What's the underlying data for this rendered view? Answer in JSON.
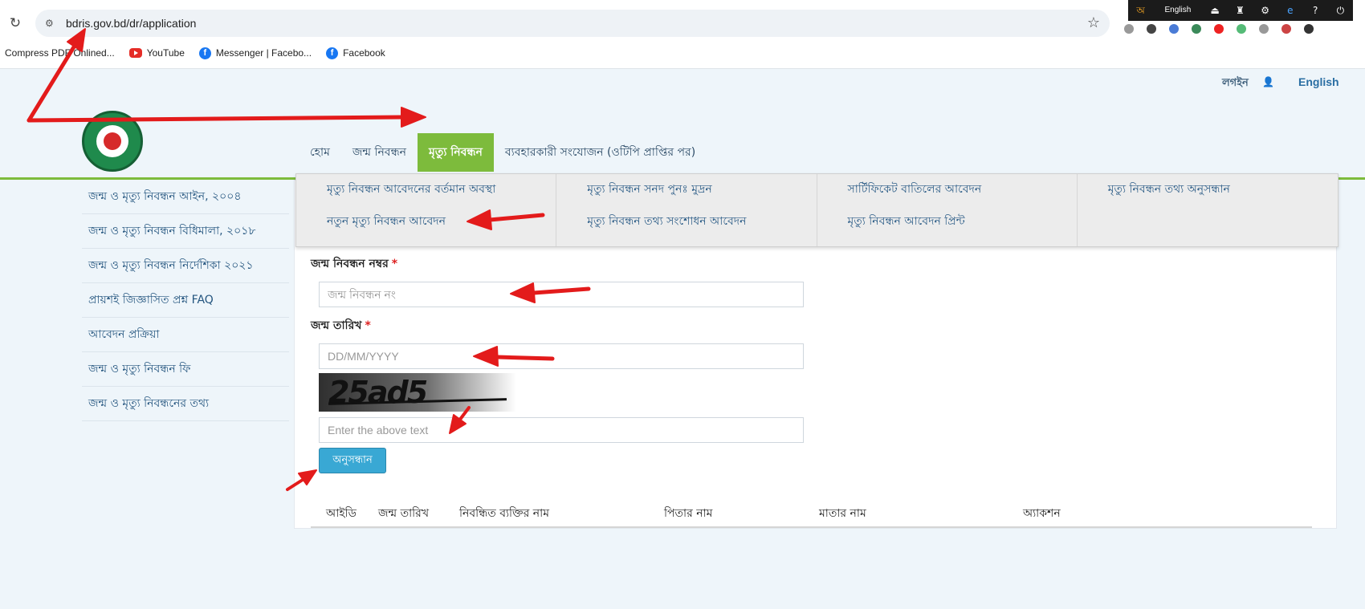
{
  "browser": {
    "url": "bdris.gov.bd/dr/application",
    "bookmarks": [
      {
        "label": "Compress PDF Onlined...",
        "icon": "pdf-icon"
      },
      {
        "label": "YouTube",
        "icon": "youtube-icon"
      },
      {
        "label": "Messenger | Facebo...",
        "icon": "facebook-icon"
      },
      {
        "label": "Facebook",
        "icon": "facebook-icon"
      }
    ],
    "extension_bar": {
      "language": "English",
      "glyph": "অ"
    }
  },
  "header": {
    "login_label": "লগইন",
    "language_label": "English"
  },
  "nav": {
    "items": [
      {
        "label": "হোম"
      },
      {
        "label": "জন্ম নিবন্ধন"
      },
      {
        "label": "মৃত্যু নিবন্ধন",
        "active": true
      },
      {
        "label": "ব্যবহারকারী সংযোজন (ওটিপি প্রাপ্তির পর)"
      }
    ]
  },
  "dropdown": {
    "columns": [
      [
        "মৃত্যু নিবন্ধন আবেদনের বর্তমান অবস্থা",
        "নতুন মৃত্যু নিবন্ধন আবেদন"
      ],
      [
        "মৃত্যু নিবন্ধন সনদ পুনঃ মুদ্রন",
        "মৃত্যু নিবন্ধন তথ্য সংশোধন আবেদন"
      ],
      [
        "সার্টিফিকেট বাতিলের আবেদন",
        "মৃত্যু নিবন্ধন আবেদন প্রিন্ট"
      ],
      [
        "মৃত্যু নিবন্ধন তথ্য অনুসন্ধান"
      ]
    ]
  },
  "sidebar": {
    "items": [
      {
        "label": "জন্ম ও মৃত্যু নিবন্ধন আইন, ২০০৪"
      },
      {
        "label": "জন্ম ও মৃত্যু নিবন্ধন বিধিমালা, ২০১৮"
      },
      {
        "label": "জন্ম ও মৃত্যু নিবন্ধন নির্দেশিকা ২০২১"
      },
      {
        "label": "প্রায়শই জিজ্ঞাসিত প্রশ্ন FAQ"
      },
      {
        "label": "আবেদন প্রক্রিয়া"
      },
      {
        "label": "জন্ম ও মৃত্যু নিবন্ধন ফি"
      },
      {
        "label": "জন্ম ও মৃত্যু নিবন্ধনের তথ্য"
      }
    ]
  },
  "form": {
    "birth_reg_label": "জন্ম নিবন্ধন নম্বর",
    "birth_reg_placeholder": "জন্ম নিবন্ধন নং",
    "dob_label": "জন্ম তারিখ",
    "dob_placeholder": "DD/MM/YYYY",
    "required_mark": "*",
    "captcha_text": "25ad5",
    "captcha_placeholder": "Enter the above text",
    "search_button": "অনুসন্ধান"
  },
  "results_table": {
    "headers": [
      "আইডি",
      "জন্ম তারিখ",
      "নিবন্ধিত ব্যক্তির নাম",
      "পিতার নাম",
      "মাতার নাম",
      "অ্যাকশন"
    ]
  },
  "colors": {
    "accent_green": "#7dbb3c",
    "button_blue": "#39a8d4",
    "annotation_red": "#e31b1b"
  }
}
